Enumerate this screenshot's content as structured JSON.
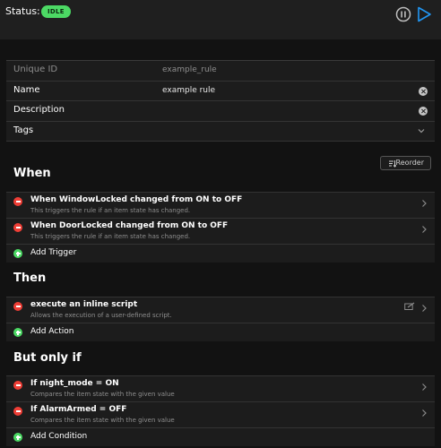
{
  "header": {
    "status_label": "Status:",
    "status_badge": "IDLE"
  },
  "properties": {
    "unique_id": {
      "key": "Unique ID",
      "value": "example_rule"
    },
    "name": {
      "key": "Name",
      "value": "example rule"
    },
    "description": {
      "key": "Description",
      "value": ""
    },
    "tags": {
      "key": "Tags"
    }
  },
  "reorder_label": "Reorder",
  "when": {
    "title": "When",
    "triggers": [
      {
        "title": "When WindowLocked changed from ON to OFF",
        "desc": "This triggers the rule if an item state has changed."
      },
      {
        "title": "When DoorLocked changed from ON to OFF",
        "desc": "This triggers the rule if an item state has changed."
      }
    ],
    "add_label": "Add Trigger"
  },
  "then": {
    "title": "Then",
    "actions": [
      {
        "title": "execute an inline script",
        "desc": "Allows the execution of a user-defined script."
      }
    ],
    "add_label": "Add Action"
  },
  "but_only_if": {
    "title": "But only if",
    "conditions": [
      {
        "title": "If night_mode = ON",
        "desc": "Compares the item state with the given value"
      },
      {
        "title": "If AlarmArmed = OFF",
        "desc": "Compares the item state with the given value"
      }
    ],
    "add_label": "Add Condition"
  },
  "colors": {
    "accent": "#2196f3",
    "idle": "#4cd964",
    "remove": "#ef3e36",
    "add": "#4cd964"
  },
  "icons": [
    "pause-icon",
    "play-icon",
    "clear-icon",
    "chevron-down-icon",
    "reorder-icon",
    "remove-icon",
    "chevron-right-icon",
    "edit-script-icon",
    "add-icon"
  ]
}
